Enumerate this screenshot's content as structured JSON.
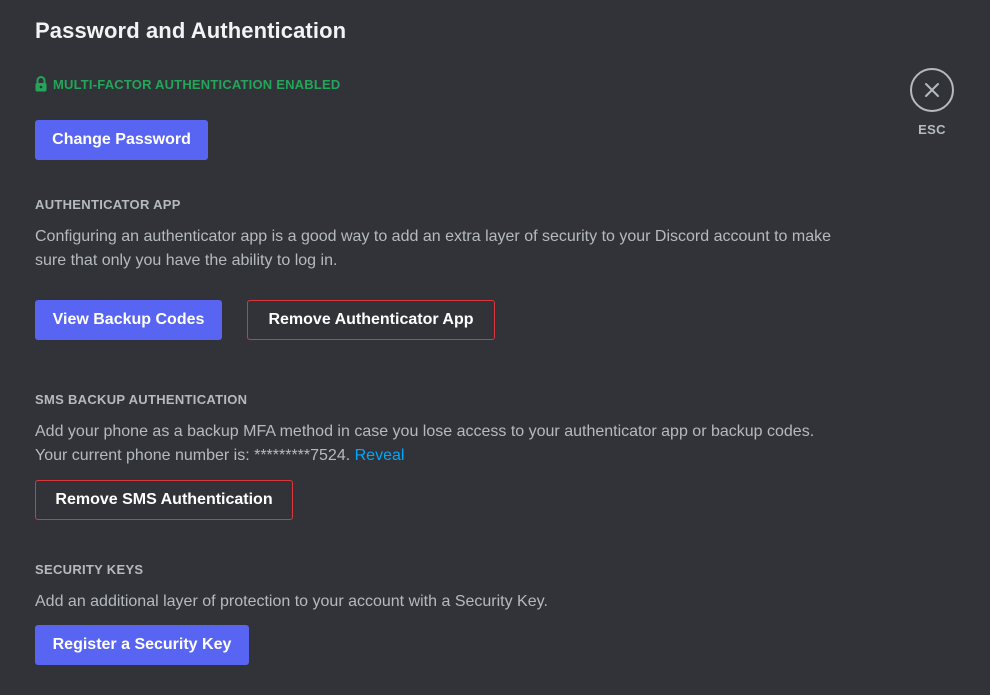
{
  "header": {
    "title": "Password and Authentication",
    "mfa_status": "MULTI-FACTOR AUTHENTICATION ENABLED",
    "mfa_icon": "lock-icon",
    "change_password_label": "Change Password"
  },
  "authenticator_app": {
    "heading": "AUTHENTICATOR APP",
    "description": "Configuring an authenticator app is a good way to add an extra layer of security to your Discord account to make sure that only you have the ability to log in.",
    "view_backup_codes_label": "View Backup Codes",
    "remove_authenticator_label": "Remove Authenticator App"
  },
  "sms_backup": {
    "heading": "SMS BACKUP AUTHENTICATION",
    "description": "Add your phone as a backup MFA method in case you lose access to your authenticator app or backup codes.",
    "phone_prefix": "Your current phone number is: ",
    "phone_masked": "*********7524.",
    "reveal_label": "Reveal",
    "remove_sms_label": "Remove SMS Authentication"
  },
  "security_keys": {
    "heading": "SECURITY KEYS",
    "description": "Add an additional layer of protection to your account with a Security Key.",
    "register_label": "Register a Security Key"
  },
  "close": {
    "icon": "close-icon",
    "label": "ESC"
  },
  "colors": {
    "background": "#313338",
    "primary": "#5865f2",
    "danger_outline": "#da373c",
    "success": "#23a55a",
    "link": "#00a8fc"
  }
}
